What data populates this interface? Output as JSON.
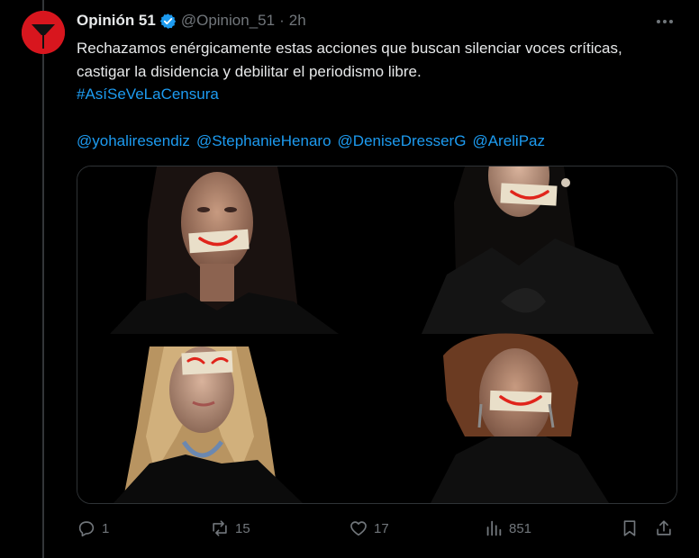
{
  "post": {
    "author_name": "Opinión 51",
    "handle": "@Opinion_51",
    "separator": "·",
    "time": "2h",
    "text": "Rechazamos enérgicamente estas acciones que buscan silenciar voces críticas, castigar la disidencia y debilitar el periodismo libre.",
    "hashtag": "#AsíSeVeLaCensura",
    "mentions": [
      "@yohaliresendiz",
      "@StephanieHenaro",
      "@DeniseDresserG",
      "@AreliPaz"
    ]
  },
  "actions": {
    "replies": "1",
    "reposts": "15",
    "likes": "17",
    "views": "851"
  },
  "colors": {
    "background": "#000000",
    "text": "#e7e9ea",
    "muted": "#71767b",
    "link": "#1d9bf0",
    "avatar_red": "#d8161e",
    "tape": "#e9dfc9",
    "tape_mark": "#e0241b"
  },
  "icons": {
    "verified": "verified-badge-icon",
    "more": "more-dots-icon",
    "reply": "reply-icon",
    "repost": "repost-icon",
    "like": "heart-icon",
    "views": "views-bar-icon",
    "bookmark": "bookmark-icon",
    "share": "share-icon"
  }
}
